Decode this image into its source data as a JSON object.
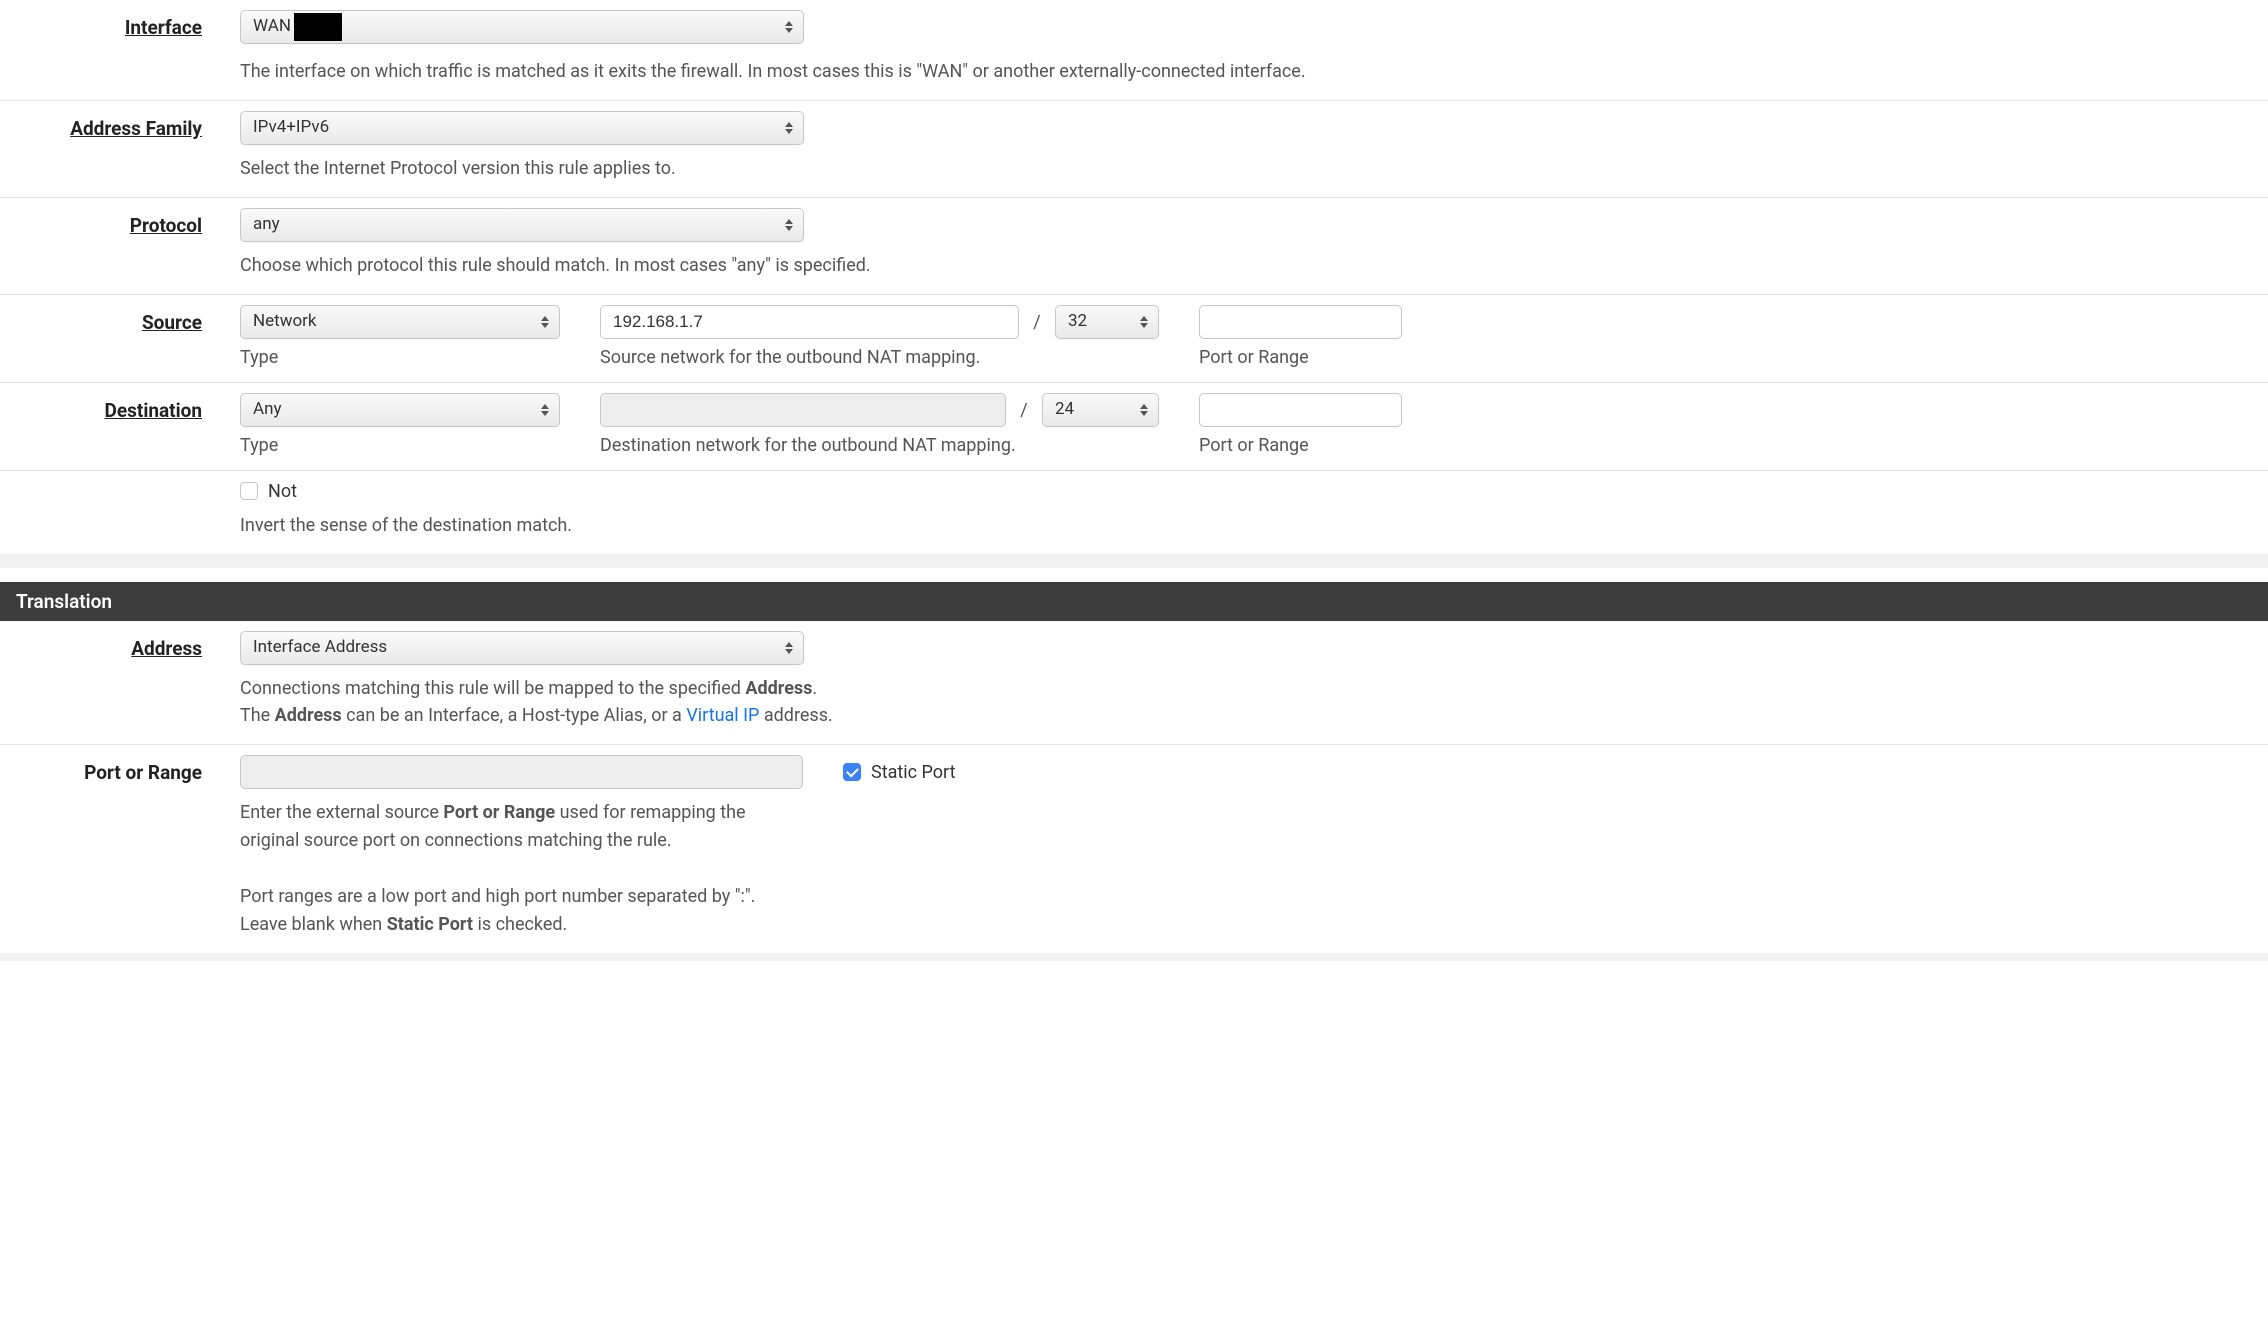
{
  "interface": {
    "label": "Interface",
    "value": "WAN",
    "help": "The interface on which traffic is matched as it exits the firewall. In most cases this is \"WAN\" or another externally-connected interface."
  },
  "address_family": {
    "label": "Address Family",
    "value": "IPv4+IPv6",
    "help": "Select the Internet Protocol version this rule applies to."
  },
  "protocol": {
    "label": "Protocol",
    "value": "any",
    "help": "Choose which protocol this rule should match. In most cases \"any\" is specified."
  },
  "source": {
    "label": "Source",
    "type_value": "Network",
    "type_sub": "Type",
    "network_value": "192.168.1.7",
    "network_sub": "Source network for the outbound NAT mapping.",
    "mask_value": "32",
    "port_value": "",
    "port_sub": "Port or Range",
    "slash": "/"
  },
  "destination": {
    "label": "Destination",
    "type_value": "Any",
    "type_sub": "Type",
    "network_value": "",
    "network_sub": "Destination network for the outbound NAT mapping.",
    "mask_value": "24",
    "port_value": "",
    "port_sub": "Port or Range",
    "slash": "/"
  },
  "not": {
    "checkbox_label": "Not",
    "help": "Invert the sense of the destination match."
  },
  "translation": {
    "section_title": "Translation",
    "address": {
      "label": "Address",
      "value": "Interface Address",
      "help_1_pre": "Connections matching this rule will be mapped to the specified ",
      "help_1_bold": "Address",
      "help_1_post": ".",
      "help_2_pre": "The ",
      "help_2_bold": "Address",
      "help_2_mid": " can be an Interface, a Host-type Alias, or a ",
      "help_2_link": "Virtual IP",
      "help_2_post": " address."
    },
    "port_or_range": {
      "label": "Port or Range",
      "static_port_label": "Static Port",
      "help_1_pre": "Enter the external source ",
      "help_1_bold": "Port or Range",
      "help_1_post": " used for remapping the original source port on connections matching the rule.",
      "help_2": "Port ranges are a low port and high port number separated by \":\".",
      "help_3_pre": "Leave blank when ",
      "help_3_bold": "Static Port",
      "help_3_post": " is checked."
    }
  }
}
